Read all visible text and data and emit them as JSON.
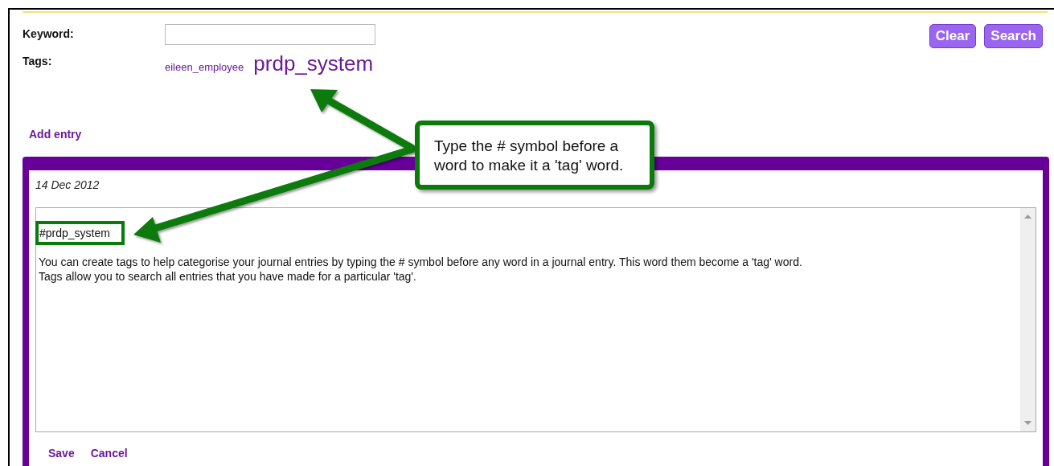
{
  "search": {
    "keyword_label": "Keyword:",
    "tags_label": "Tags:",
    "tags": [
      {
        "label": "eileen_employee",
        "kind": "small"
      },
      {
        "label": "prdp_system",
        "kind": "large"
      }
    ],
    "buttons": [
      "Clear",
      "Search"
    ]
  },
  "add_entry": "Add entry",
  "entry": {
    "date": "14 Dec 2012",
    "lines": [
      {
        "text": "#prdp_system",
        "kind": "tag"
      },
      {
        "text": "You can create tags to help categorise your journal entries by typing the # symbol before any word in a journal entry.  This word them become a 'tag' word.",
        "kind": "body"
      },
      {
        "text": "Tags allow you to search all entries that you have made for a particular 'tag'.",
        "kind": "body"
      }
    ],
    "actions": [
      "Save",
      "Cancel"
    ]
  },
  "callout": {
    "text": "Type the # symbol before a word to make it a 'tag' word."
  }
}
